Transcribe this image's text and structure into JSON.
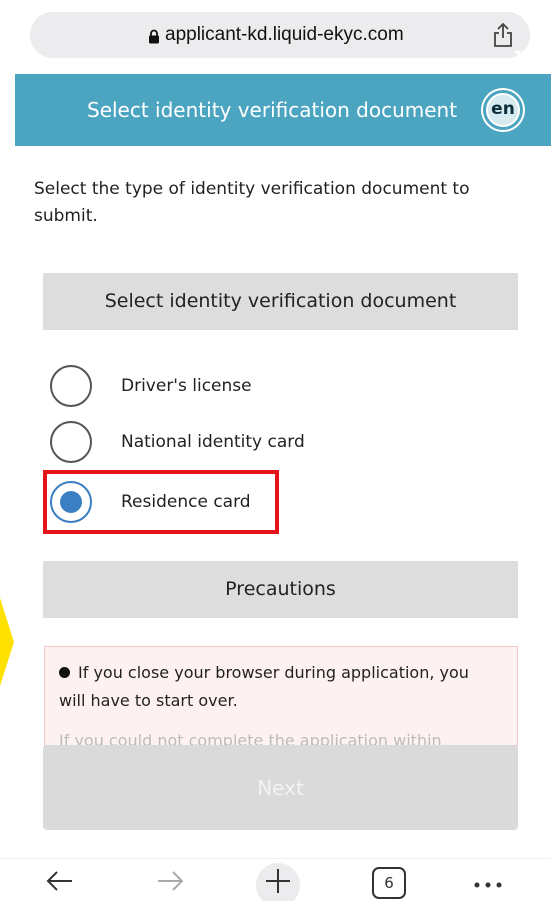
{
  "browser": {
    "url": "applicant-kd.liquid-ekyc.com",
    "tabs_count": "6"
  },
  "header": {
    "title": "Select identity verification document",
    "language": "en"
  },
  "intro_text": "Select the type of identity verification document to submit.",
  "document_section": {
    "title": "Select identity verification document",
    "options": [
      {
        "label": "Driver's license",
        "checked": false
      },
      {
        "label": "National identity card",
        "checked": false
      },
      {
        "label": "Residence card",
        "checked": true
      }
    ]
  },
  "precautions": {
    "title": "Precautions",
    "items": [
      "If you close your browser during application, you will have to start over.",
      "If you could not complete the application within"
    ]
  },
  "next_button": "Next",
  "colors": {
    "header": "#4ba5c1",
    "selected_radio": "#3a7fc4",
    "highlight": "#e4141b",
    "disabled_button": "#dadada"
  }
}
